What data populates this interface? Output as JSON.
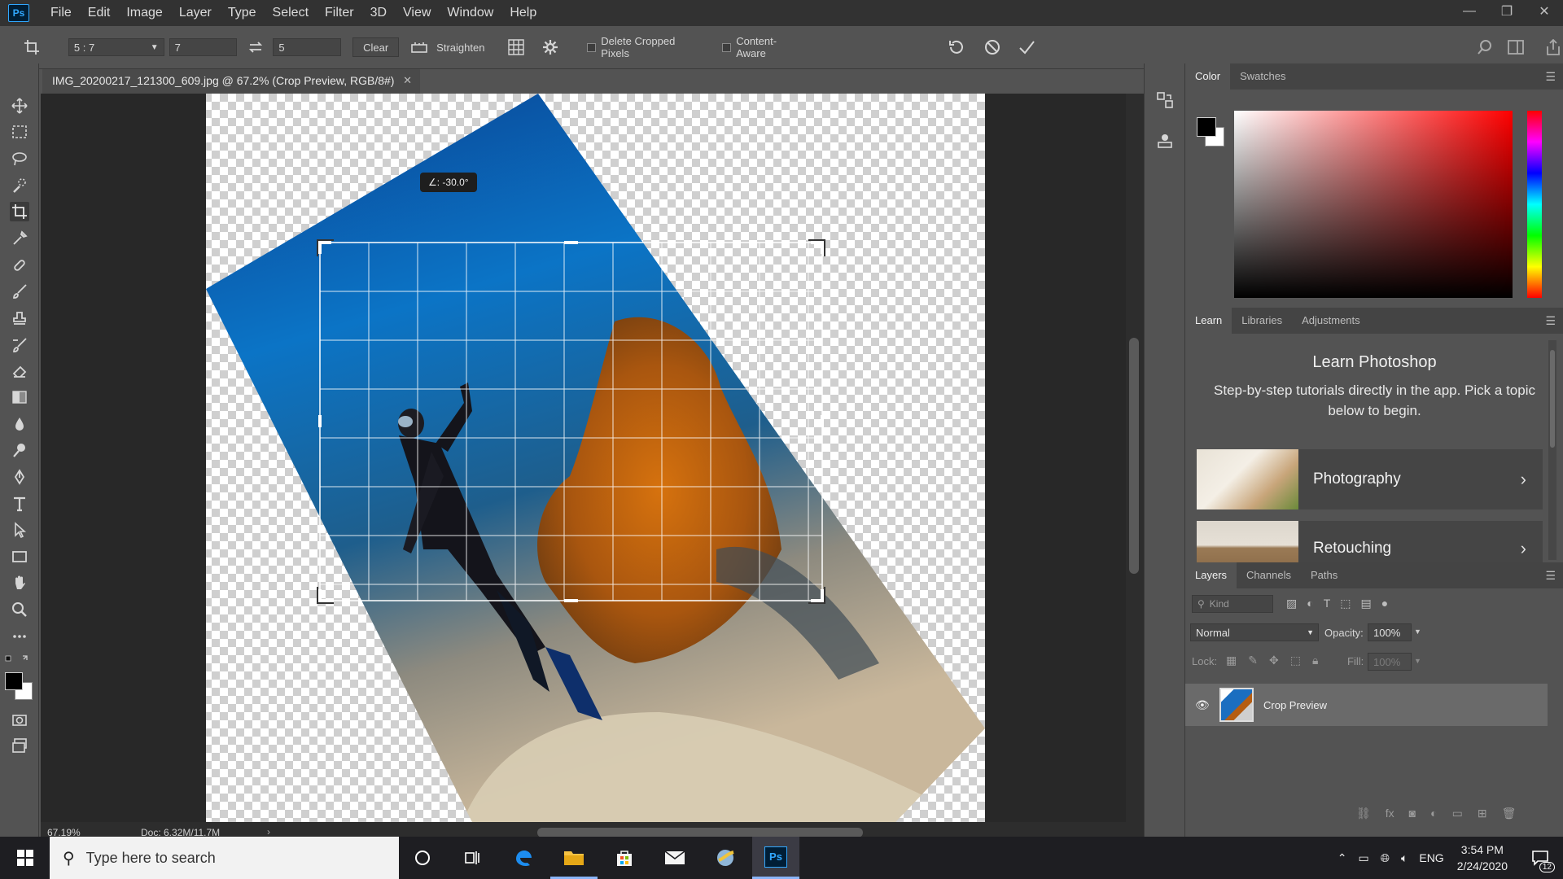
{
  "app": {
    "logo": "Ps"
  },
  "menu": [
    "File",
    "Edit",
    "Image",
    "Layer",
    "Type",
    "Select",
    "Filter",
    "3D",
    "View",
    "Window",
    "Help"
  ],
  "window_controls": {
    "minimize": "—",
    "restore": "❐",
    "close": "✕"
  },
  "options": {
    "ratio": "5 : 7",
    "width": "7",
    "height": "5",
    "clear": "Clear",
    "straighten": "Straighten",
    "delete_cropped": "Delete Cropped Pixels",
    "content_aware": "Content-Aware"
  },
  "document": {
    "tab_title": "IMG_20200217_121300_609.jpg @ 67.2% (Crop Preview, RGB/8#)",
    "angle": "∠: -30.0°",
    "zoom": "67.19%",
    "doc_info": "Doc: 6.32M/11.7M"
  },
  "color_panel": {
    "tabs": [
      "Color",
      "Swatches"
    ],
    "fg": "#000000",
    "bg": "#ffffff"
  },
  "learn_panel": {
    "tabs": [
      "Learn",
      "Libraries",
      "Adjustments"
    ],
    "title": "Learn Photoshop",
    "description": "Step-by-step tutorials directly in the app. Pick a topic below to begin.",
    "cards": [
      "Photography",
      "Retouching"
    ]
  },
  "layers_panel": {
    "tabs": [
      "Layers",
      "Channels",
      "Paths"
    ],
    "kind_placeholder": "Kind",
    "blend_mode": "Normal",
    "opacity_label": "Opacity:",
    "opacity": "100%",
    "lock_label": "Lock:",
    "fill_label": "Fill:",
    "fill": "100%",
    "layers": [
      "Crop Preview"
    ]
  },
  "taskbar": {
    "search_placeholder": "Type here to search",
    "lang": "ENG",
    "time": "3:54 PM",
    "date": "2/24/2020",
    "notifications": "12"
  }
}
